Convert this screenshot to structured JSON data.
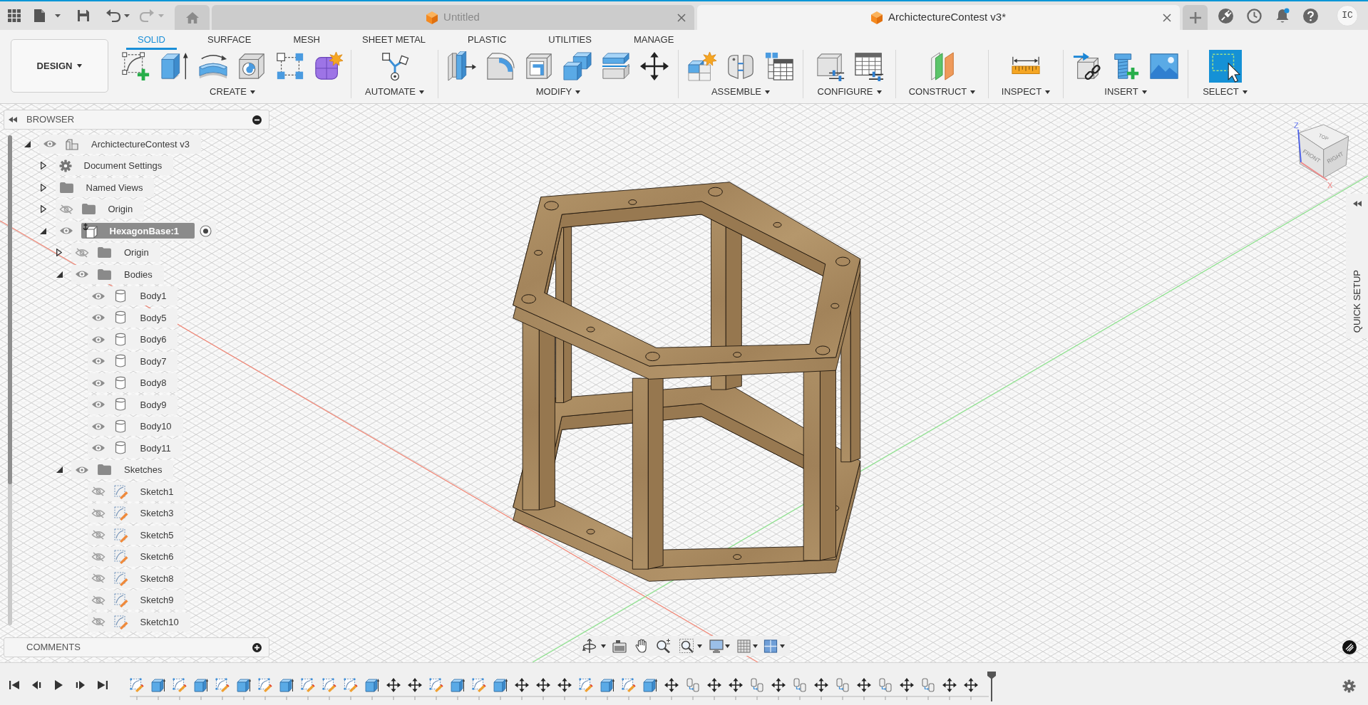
{
  "top_bar": {
    "tabs": [
      {
        "title": "Untitled",
        "selected": false
      },
      {
        "title": "ArchictectureContest v3*",
        "selected": true
      }
    ],
    "user_initials": "IC"
  },
  "toolbar": {
    "workspace": "DESIGN",
    "tabs": [
      {
        "label": "SOLID",
        "selected": true
      },
      {
        "label": "SURFACE",
        "selected": false
      },
      {
        "label": "MESH",
        "selected": false
      },
      {
        "label": "SHEET METAL",
        "selected": false
      },
      {
        "label": "PLASTIC",
        "selected": false
      },
      {
        "label": "UTILITIES",
        "selected": false
      },
      {
        "label": "MANAGE",
        "selected": false
      }
    ],
    "groups": [
      "CREATE",
      "AUTOMATE",
      "MODIFY",
      "ASSEMBLE",
      "CONFIGURE",
      "CONSTRUCT",
      "INSPECT",
      "INSERT",
      "SELECT"
    ]
  },
  "browser": {
    "title": "BROWSER",
    "tree": [
      {
        "label": "ArchictectureContest v3",
        "kind": "document",
        "visible": true,
        "expanded": true,
        "children": [
          {
            "label": "Document Settings",
            "kind": "settings",
            "expanded": false
          },
          {
            "label": "Named Views",
            "kind": "folder",
            "expanded": false
          },
          {
            "label": "Origin",
            "kind": "folder",
            "visible": false,
            "expanded": false
          },
          {
            "label": "HexagonBase:1",
            "kind": "component",
            "visible": true,
            "expanded": true,
            "active": true,
            "grounded": true,
            "children": [
              {
                "label": "Origin",
                "kind": "folder",
                "visible": false,
                "expanded": false
              },
              {
                "label": "Bodies",
                "kind": "folder",
                "visible": true,
                "expanded": true,
                "children": [
                  {
                    "label": "Body1",
                    "kind": "body",
                    "visible": true
                  },
                  {
                    "label": "Body5",
                    "kind": "body",
                    "visible": true
                  },
                  {
                    "label": "Body6",
                    "kind": "body",
                    "visible": true
                  },
                  {
                    "label": "Body7",
                    "kind": "body",
                    "visible": true
                  },
                  {
                    "label": "Body8",
                    "kind": "body",
                    "visible": true
                  },
                  {
                    "label": "Body9",
                    "kind": "body",
                    "visible": true
                  },
                  {
                    "label": "Body10",
                    "kind": "body",
                    "visible": true
                  },
                  {
                    "label": "Body11",
                    "kind": "body",
                    "visible": true
                  }
                ]
              },
              {
                "label": "Sketches",
                "kind": "folder",
                "visible": true,
                "expanded": true,
                "children": [
                  {
                    "label": "Sketch1",
                    "kind": "sketch",
                    "visible": false
                  },
                  {
                    "label": "Sketch3",
                    "kind": "sketch",
                    "visible": false
                  },
                  {
                    "label": "Sketch5",
                    "kind": "sketch",
                    "visible": false
                  },
                  {
                    "label": "Sketch6",
                    "kind": "sketch",
                    "visible": false
                  },
                  {
                    "label": "Sketch8",
                    "kind": "sketch",
                    "visible": false
                  },
                  {
                    "label": "Sketch9",
                    "kind": "sketch",
                    "visible": false
                  },
                  {
                    "label": "Sketch10",
                    "kind": "sketch",
                    "visible": false
                  }
                ]
              }
            ]
          }
        ]
      }
    ]
  },
  "comments": {
    "title": "COMMENTS"
  },
  "viewcube": {
    "top": "TOP",
    "front": "FRONT",
    "right": "RIGHT",
    "z_axis": "Z",
    "x_axis": "X"
  },
  "quick_setup": {
    "label": "QUICK SETUP"
  },
  "timeline": {
    "features": [
      {
        "kind": "sketch"
      },
      {
        "kind": "extrude"
      },
      {
        "kind": "sketch"
      },
      {
        "kind": "extrude"
      },
      {
        "kind": "sketch"
      },
      {
        "kind": "extrude"
      },
      {
        "kind": "sketch"
      },
      {
        "kind": "extrude"
      },
      {
        "kind": "sketch"
      },
      {
        "kind": "sketch"
      },
      {
        "kind": "sketch"
      },
      {
        "kind": "extrude"
      },
      {
        "kind": "move"
      },
      {
        "kind": "move"
      },
      {
        "kind": "sketch"
      },
      {
        "kind": "extrude"
      },
      {
        "kind": "sketch"
      },
      {
        "kind": "extrude"
      },
      {
        "kind": "move"
      },
      {
        "kind": "move"
      },
      {
        "kind": "move"
      },
      {
        "kind": "sketch"
      },
      {
        "kind": "extrude"
      },
      {
        "kind": "sketch"
      },
      {
        "kind": "extrude"
      },
      {
        "kind": "move"
      },
      {
        "kind": "joint"
      },
      {
        "kind": "move"
      },
      {
        "kind": "move"
      },
      {
        "kind": "joint"
      },
      {
        "kind": "move"
      },
      {
        "kind": "joint"
      },
      {
        "kind": "move"
      },
      {
        "kind": "joint"
      },
      {
        "kind": "move"
      },
      {
        "kind": "joint"
      },
      {
        "kind": "move"
      },
      {
        "kind": "joint"
      },
      {
        "kind": "move"
      },
      {
        "kind": "move"
      }
    ]
  }
}
